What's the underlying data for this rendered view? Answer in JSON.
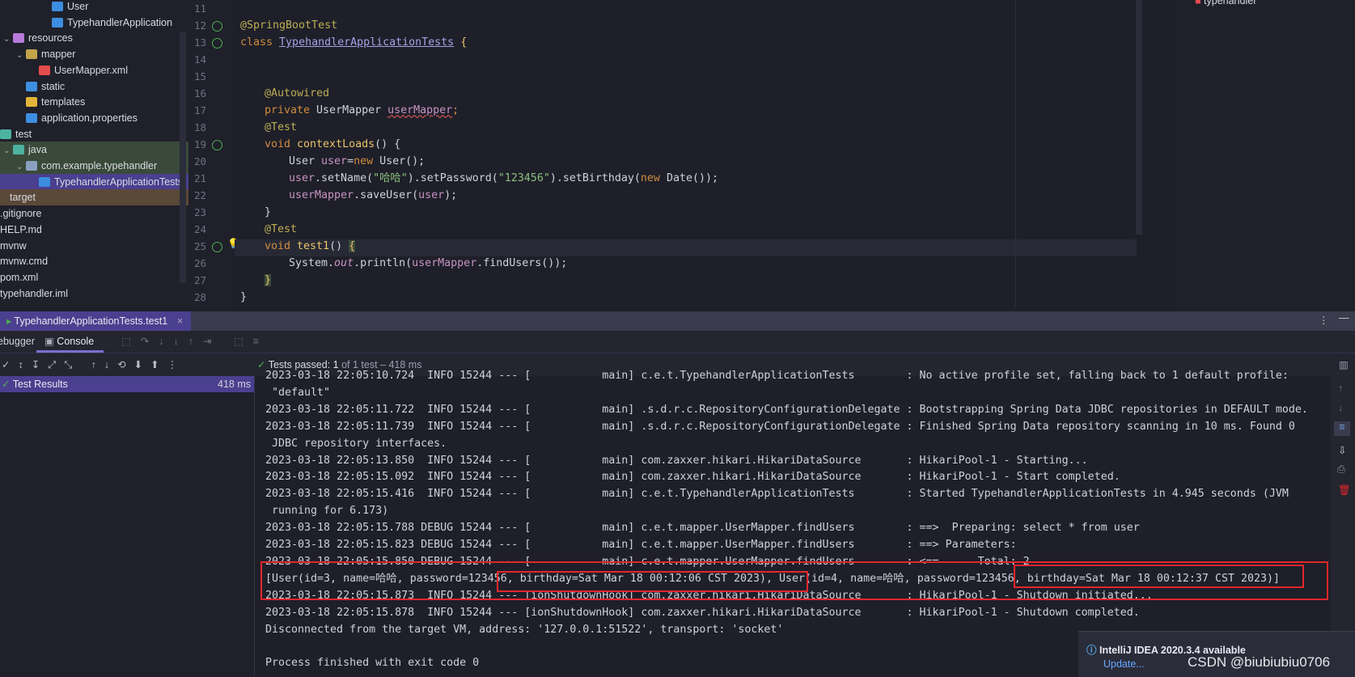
{
  "project_tree": [
    {
      "label": "User",
      "icon": "class-icon",
      "color": "#3d8ee0"
    },
    {
      "label": "TypehandlerApplication",
      "icon": "spring-class-icon",
      "color": "#3d8ee0"
    },
    {
      "label": "resources",
      "icon": "folder-icon",
      "color": "#b67ad9"
    },
    {
      "label": "mapper",
      "icon": "folder-icon",
      "color": "#c2a34a"
    },
    {
      "label": "UserMapper.xml",
      "icon": "xml-icon",
      "color": "#e34c4c"
    },
    {
      "label": "static",
      "icon": "folder-icon",
      "color": "#3d8ee0"
    },
    {
      "label": "templates",
      "icon": "folder-icon",
      "color": "#e4b43a"
    },
    {
      "label": "application.properties",
      "icon": "properties-icon",
      "color": "#3d8ee0"
    },
    {
      "label": "test",
      "icon": "folder-icon",
      "color": "#4cb3a0"
    },
    {
      "label": "java",
      "icon": "folder-icon",
      "color": "#4cb3a0"
    },
    {
      "label": "com.example.typehandler",
      "icon": "package-icon",
      "color": "#8aa0c0"
    },
    {
      "label": "TypehandlerApplicationTests",
      "icon": "test-class-icon",
      "color": "#3d8ee0"
    },
    {
      "label": "target",
      "icon": "folder-icon",
      "color": "#c28a3a"
    },
    {
      "label": ".gitignore",
      "icon": "file-icon",
      "color": "#8a8f9e"
    },
    {
      "label": "HELP.md",
      "icon": "file-icon",
      "color": "#8a8f9e"
    },
    {
      "label": "mvnw",
      "icon": "file-icon",
      "color": "#8a8f9e"
    },
    {
      "label": "mvnw.cmd",
      "icon": "file-icon",
      "color": "#8a8f9e"
    },
    {
      "label": "pom.xml",
      "icon": "file-icon",
      "color": "#8a8f9e"
    },
    {
      "label": "typehandler.iml",
      "icon": "file-icon",
      "color": "#8a8f9e"
    }
  ],
  "editor": {
    "line_numbers": [
      "11",
      "12",
      "13",
      "14",
      "15",
      "16",
      "17",
      "18",
      "19",
      "20",
      "21",
      "22",
      "23",
      "24",
      "25",
      "26",
      "27",
      "28"
    ],
    "lines": [
      "@SpringBootTest",
      "class TypehandlerApplicationTests {",
      "@Autowired",
      "private UserMapper userMapper;",
      "@Test",
      "void contextLoads() {",
      "User user=new User();",
      "user.setName(\"哈哈\").setPassword(\"123456\").setBirthday(new Date());",
      "userMapper.saveUser(user);",
      "}",
      "@Test",
      "void test1() {",
      "System.out.println(userMapper.findUsers());",
      "}",
      "}"
    ],
    "right_panel_item": "typehandler"
  },
  "run_window": {
    "tab_title": "TypehandlerApplicationTests.test1",
    "debugger_tab": "Debugger",
    "console_tab": "Console",
    "status_prefix": "Tests passed:",
    "status_count": "1",
    "status_suffix": "of 1 test – 418 ms",
    "results_label": "Test Results",
    "results_time": "418 ms"
  },
  "console_lines": [
    "2023-03-18 22:05:10.724  INFO 15244 --- [           main] c.e.t.TypehandlerApplicationTests        : No active profile set, falling back to 1 default profile:",
    " \"default\"",
    "2023-03-18 22:05:11.722  INFO 15244 --- [           main] .s.d.r.c.RepositoryConfigurationDelegate : Bootstrapping Spring Data JDBC repositories in DEFAULT mode.",
    "2023-03-18 22:05:11.739  INFO 15244 --- [           main] .s.d.r.c.RepositoryConfigurationDelegate : Finished Spring Data repository scanning in 10 ms. Found 0",
    " JDBC repository interfaces.",
    "2023-03-18 22:05:13.850  INFO 15244 --- [           main] com.zaxxer.hikari.HikariDataSource       : HikariPool-1 - Starting...",
    "2023-03-18 22:05:15.092  INFO 15244 --- [           main] com.zaxxer.hikari.HikariDataSource       : HikariPool-1 - Start completed.",
    "2023-03-18 22:05:15.416  INFO 15244 --- [           main] c.e.t.TypehandlerApplicationTests        : Started TypehandlerApplicationTests in 4.945 seconds (JVM",
    " running for 6.173)",
    "2023-03-18 22:05:15.788 DEBUG 15244 --- [           main] c.e.t.mapper.UserMapper.findUsers        : ==>  Preparing: select * from user",
    "2023-03-18 22:05:15.823 DEBUG 15244 --- [           main] c.e.t.mapper.UserMapper.findUsers        : ==> Parameters: ",
    "2023-03-18 22:05:15.850 DEBUG 15244 --- [           main] c.e.t.mapper.UserMapper.findUsers        : <==      Total: 2",
    "[User(id=3, name=哈哈, password=123456, birthday=Sat Mar 18 00:12:06 CST 2023), User(id=4, name=哈哈, password=123456, birthday=Sat Mar 18 00:12:37 CST 2023)]",
    "2023-03-18 22:05:15.873  INFO 15244 --- [ionShutdownHook] com.zaxxer.hikari.HikariDataSource       : HikariPool-1 - Shutdown initiated...",
    "2023-03-18 22:05:15.878  INFO 15244 --- [ionShutdownHook] com.zaxxer.hikari.HikariDataSource       : HikariPool-1 - Shutdown completed.",
    "Disconnected from the target VM, address: '127.0.0.1:51522', transport: 'socket'",
    "",
    "Process finished with exit code 0"
  ],
  "notification": {
    "title": "IntelliJ IDEA 2020.3.4 available",
    "link": "Update..."
  },
  "watermark": "CSDN @biubiubiu0706",
  "colors": {
    "highlight_box": "#e5262a",
    "pass_green": "#4caf50",
    "accent_purple": "#4b3f8f"
  }
}
